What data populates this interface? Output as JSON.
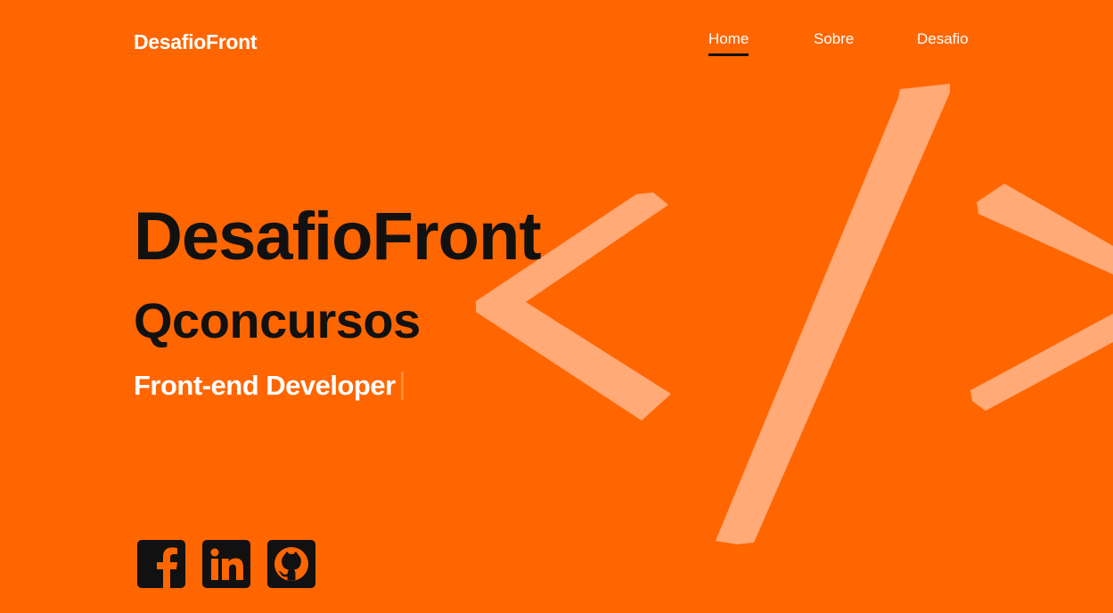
{
  "header": {
    "brand": "DesafioFront",
    "nav": [
      {
        "label": "Home",
        "active": true
      },
      {
        "label": "Sobre",
        "active": false
      },
      {
        "label": "Desafio",
        "active": false
      }
    ]
  },
  "hero": {
    "title": "DesafioFront",
    "subtitle": "Qconcursos",
    "role": "Front-end Developer"
  },
  "socials": [
    {
      "icon": "facebook-icon"
    },
    {
      "icon": "linkedin-icon"
    },
    {
      "icon": "github-icon"
    }
  ],
  "colors": {
    "background": "#ff6600",
    "code_symbol": "#ffaa77",
    "heading": "#111111",
    "light_text": "#ffffff"
  }
}
